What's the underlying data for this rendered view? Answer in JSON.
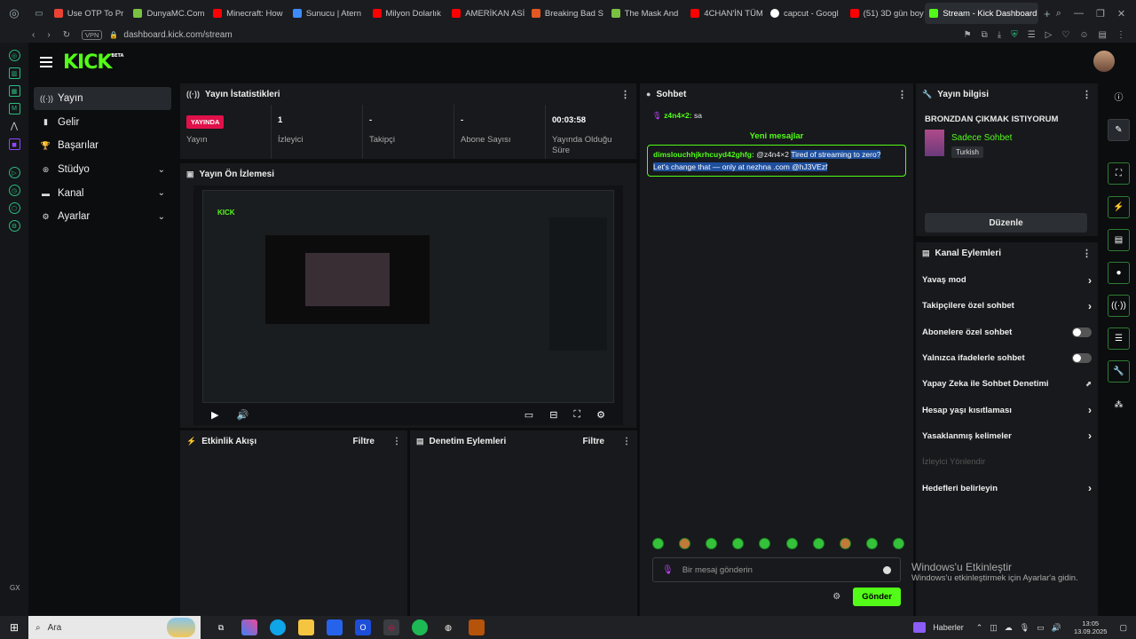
{
  "browser": {
    "tabs": [
      {
        "label": "Use OTP To Pr",
        "color": "#ea4335"
      },
      {
        "label": "DunyaMC.Com",
        "color": "#7ac142"
      },
      {
        "label": "Minecraft: How",
        "color": "#ff0000"
      },
      {
        "label": "Sunucu | Atern",
        "color": "#3d8bfd"
      },
      {
        "label": "Milyon Dolarlık",
        "color": "#ff0000"
      },
      {
        "label": "AMERİKAN ASİ",
        "color": "#ff0000"
      },
      {
        "label": "Breaking Bad S",
        "color": "#e25822"
      },
      {
        "label": "The Mask And",
        "color": "#7ac142"
      },
      {
        "label": "4CHAN'İN TÜM",
        "color": "#ff0000"
      },
      {
        "label": "capcut - Googl",
        "color": "#ffffff"
      },
      {
        "label": "(51) 3D gün boy",
        "color": "#ff0000"
      }
    ],
    "active_tab": "Stream - Kick Dashboard",
    "new_tab_symbol": "+",
    "url": "dashboard.kick.com/stream",
    "vpn_label": "VPN"
  },
  "header": {
    "logo": "KICK",
    "logo_badge": "BETA"
  },
  "nav": {
    "items": [
      {
        "label": "Yayın",
        "icon": "broadcast-icon"
      },
      {
        "label": "Gelir",
        "icon": "revenue-icon"
      },
      {
        "label": "Başarılar",
        "icon": "trophy-icon"
      },
      {
        "label": "Stüdyo",
        "icon": "studio-icon"
      },
      {
        "label": "Kanal",
        "icon": "channel-icon"
      },
      {
        "label": "Ayarlar",
        "icon": "gear-icon"
      }
    ]
  },
  "stats": {
    "title": "Yayın İstatistikleri",
    "live_badge": "YAYINDA",
    "items": [
      {
        "label": "Yayın",
        "value": ""
      },
      {
        "label": "İzleyici",
        "value": "1"
      },
      {
        "label": "Takipçi",
        "value": "-"
      },
      {
        "label": "Abone Sayısı",
        "value": "-"
      },
      {
        "label": "Yayında Olduğu Süre",
        "value": "00:03:58"
      }
    ]
  },
  "preview": {
    "title": "Yayın Ön İzlemesi",
    "inner_logo": "KICK"
  },
  "activity": {
    "title": "Etkinlik Akışı",
    "filter": "Filtre"
  },
  "moderation": {
    "title": "Denetim Eylemleri",
    "filter": "Filtre"
  },
  "chat": {
    "title": "Sohbet",
    "first_user": "z4n4×2:",
    "first_text": "sa",
    "new_messages": "Yeni mesajlar",
    "message_user": "dimslouchhjkrhcuyd42ghfg:",
    "message_mention": "@z4n4×2",
    "message_text_1": "Tired of streaming to zero?",
    "message_text_2": "Let's change that — only at nezhna .com @hJ3VEzf",
    "input_placeholder": "Bir mesaj gönderin",
    "send_label": "Gönder"
  },
  "info": {
    "title": "Yayın bilgisi",
    "stream_title": "BRONZDAN ÇIKMAK ISTIYORUM",
    "category": "Sadece Sohbet",
    "language_tag": "Turkish",
    "edit_label": "Düzenle"
  },
  "actions": {
    "title": "Kanal Eylemleri",
    "items": [
      {
        "label": "Yavaş mod",
        "type": "arrow"
      },
      {
        "label": "Takipçilere özel sohbet",
        "type": "arrow"
      },
      {
        "label": "Abonelere özel sohbet",
        "type": "toggle",
        "on": false
      },
      {
        "label": "Yalnızca ifadelerle sohbet",
        "type": "toggle",
        "on": false
      },
      {
        "label": "Yapay Zeka ile Sohbet Denetimi",
        "type": "external"
      },
      {
        "label": "Hesap yaşı kısıtlaması",
        "type": "arrow"
      },
      {
        "label": "Yasaklanmış kelimeler",
        "type": "arrow"
      },
      {
        "label": "İzleyici Yönlendir",
        "type": "disabled"
      },
      {
        "label": "Hedefleri belirleyin",
        "type": "arrow"
      }
    ]
  },
  "windows_activation": {
    "title": "Windows'u Etkinleştir",
    "subtitle": "Windows'u etkinleştirmek için Ayarlar'a gidin."
  },
  "taskbar": {
    "search_placeholder": "Ara",
    "news_label": "Haberler",
    "time": "13:05",
    "date": "13.09.2025"
  },
  "colors": {
    "accent": "#53fc18",
    "live": "#e0114a"
  }
}
